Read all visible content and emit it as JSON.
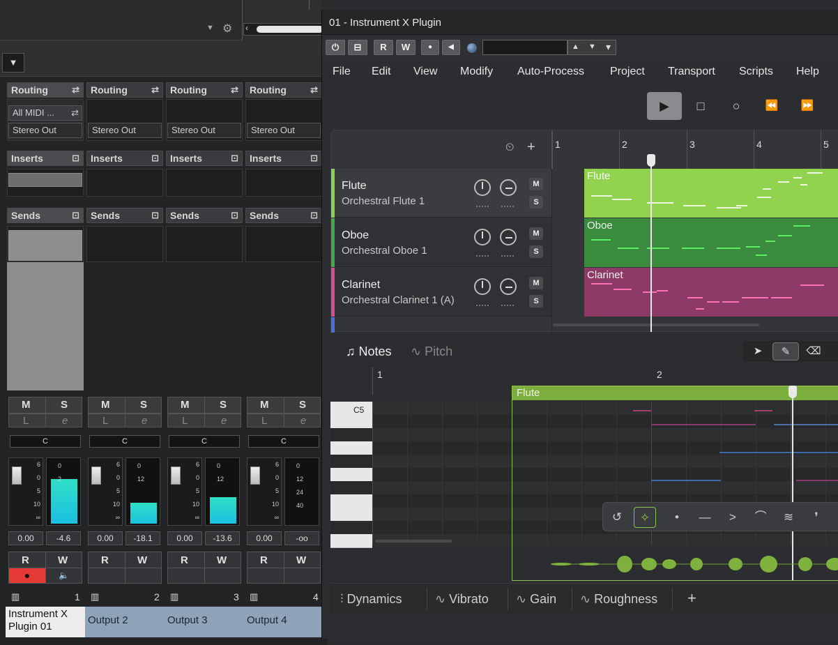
{
  "mixer": {
    "strips": [
      {
        "routing_label": "Routing",
        "input": "All MIDI ...",
        "output": "Stereo Out",
        "inserts_label": "Inserts",
        "sends_label": "Sends",
        "mute": "M",
        "solo": "S",
        "listen": "L",
        "edit": "e",
        "pan": "C",
        "volume": "0.00",
        "peak": "-4.6",
        "read": "R",
        "write": "W",
        "number": "1",
        "name": "Instrument X Plugin 01",
        "fader_ticks": [
          "6",
          "0",
          "5",
          "10",
          "∞"
        ],
        "meter_ticks": [
          "0",
          "2"
        ]
      },
      {
        "routing_label": "Routing",
        "output": "Stereo Out",
        "inserts_label": "Inserts",
        "sends_label": "Sends",
        "mute": "M",
        "solo": "S",
        "listen": "L",
        "edit": "e",
        "pan": "C",
        "volume": "0.00",
        "peak": "-18.1",
        "read": "R",
        "write": "W",
        "number": "2",
        "name": "Output 2",
        "fader_ticks": [
          "6",
          "0",
          "5",
          "10",
          "∞"
        ],
        "meter_ticks": [
          "0",
          "12"
        ]
      },
      {
        "routing_label": "Routing",
        "output": "Stereo Out",
        "inserts_label": "Inserts",
        "sends_label": "Sends",
        "mute": "M",
        "solo": "S",
        "listen": "L",
        "edit": "e",
        "pan": "C",
        "volume": "0.00",
        "peak": "-13.6",
        "read": "R",
        "write": "W",
        "number": "3",
        "name": "Output 3",
        "fader_ticks": [
          "6",
          "0",
          "5",
          "10",
          "∞"
        ],
        "meter_ticks": [
          "0",
          "12"
        ]
      },
      {
        "routing_label": "Routing",
        "output": "Stereo Out",
        "inserts_label": "Inserts",
        "sends_label": "Sends",
        "mute": "M",
        "solo": "S",
        "listen": "L",
        "edit": "e",
        "pan": "C",
        "volume": "0.00",
        "peak": "-oo",
        "read": "R",
        "write": "W",
        "number": "4",
        "name": "Output 4",
        "fader_ticks": [
          "6",
          "0",
          "5",
          "10",
          "∞"
        ],
        "meter_ticks": [
          "0",
          "12",
          "24",
          "40"
        ]
      }
    ],
    "meter_levels": [
      0.8,
      0.37,
      0.47,
      0.0
    ]
  },
  "plugin": {
    "title": "01 - Instrument X Plugin",
    "toolbar": {
      "power": "⏻",
      "bypass": "⊟",
      "read": "R",
      "write": "W",
      "record": "●",
      "back": "◀",
      "preset_value": "",
      "nav_up": "▲",
      "nav_down": "▼",
      "menu": "▾"
    },
    "menu": [
      "File",
      "Edit",
      "View",
      "Modify",
      "Auto-Process",
      "Project",
      "Transport",
      "Scripts",
      "Help"
    ],
    "transport": {
      "play": "▶",
      "stop": "□",
      "record": "○",
      "rewind": "⏪",
      "forward": "⏩"
    },
    "arranger": {
      "ruler": [
        "1",
        "2",
        "3",
        "4",
        "5"
      ],
      "tracks": [
        {
          "name": "Flute",
          "instrument": "Orchestral Flute 1",
          "mute": "M",
          "solo": "S",
          "color": "#8bd14e",
          "clip": "Flute",
          "clip_color": "#91d34f",
          "note_color": "#eef7df"
        },
        {
          "name": "Oboe",
          "instrument": "Orchestral Oboe 1",
          "mute": "M",
          "solo": "S",
          "color": "#3dab45",
          "clip": "Oboe",
          "clip_color": "#3a8b3e",
          "note_color": "#5df064"
        },
        {
          "name": "Clarinet",
          "instrument": "Orchestral Clarinet 1 (A)",
          "mute": "M",
          "solo": "S",
          "color": "#d74d8f",
          "clip": "Clarinet",
          "clip_color": "#8e3a66",
          "note_color": "#ff72b8"
        }
      ]
    },
    "editor": {
      "notes_tab": "Notes",
      "pitch_tab": "Pitch",
      "ruler": [
        "1",
        "2"
      ],
      "key_label": "C5",
      "region": "Flute",
      "bottom_tabs": [
        "Dynamics",
        "Vibrato",
        "Gain",
        "Roughness"
      ],
      "add": "+"
    }
  }
}
